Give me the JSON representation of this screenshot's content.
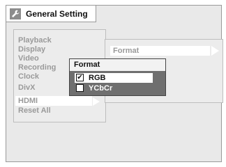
{
  "header": {
    "title": "General Setting",
    "icon": "wrench-icon"
  },
  "menu": {
    "items": [
      "Playback",
      "Display",
      "Video",
      "Recording",
      "Clock",
      "DivX",
      "HDMI",
      "Reset All"
    ],
    "selected": "HDMI"
  },
  "submenu": {
    "item": "Format"
  },
  "popup": {
    "title": "Format",
    "options": [
      {
        "label": "RGB",
        "checked": true,
        "check_glyph": "✔"
      },
      {
        "label": "YCbCr",
        "checked": false,
        "check_glyph": ""
      }
    ]
  },
  "colors": {
    "background": "#e9e9e9",
    "menu_text": "#9a9a9a",
    "popup_body": "#6f6f6f",
    "highlight": "#ffffff"
  }
}
